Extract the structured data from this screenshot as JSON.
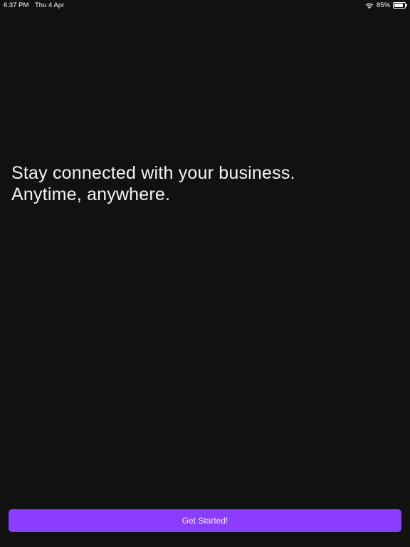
{
  "status_bar": {
    "time": "6:37 PM",
    "date": "Thu 4 Apr",
    "battery_percent": "85%",
    "battery_level": 0.85,
    "icons": [
      "wifi-icon",
      "battery-icon"
    ]
  },
  "onboarding": {
    "headline_line1": "Stay connected with your business.",
    "headline_line2": "Anytime, anywhere."
  },
  "cta": {
    "label": "Get Started!"
  },
  "colors": {
    "background": "#111112",
    "accent": "#8b3dff",
    "text": "#ffffff"
  }
}
